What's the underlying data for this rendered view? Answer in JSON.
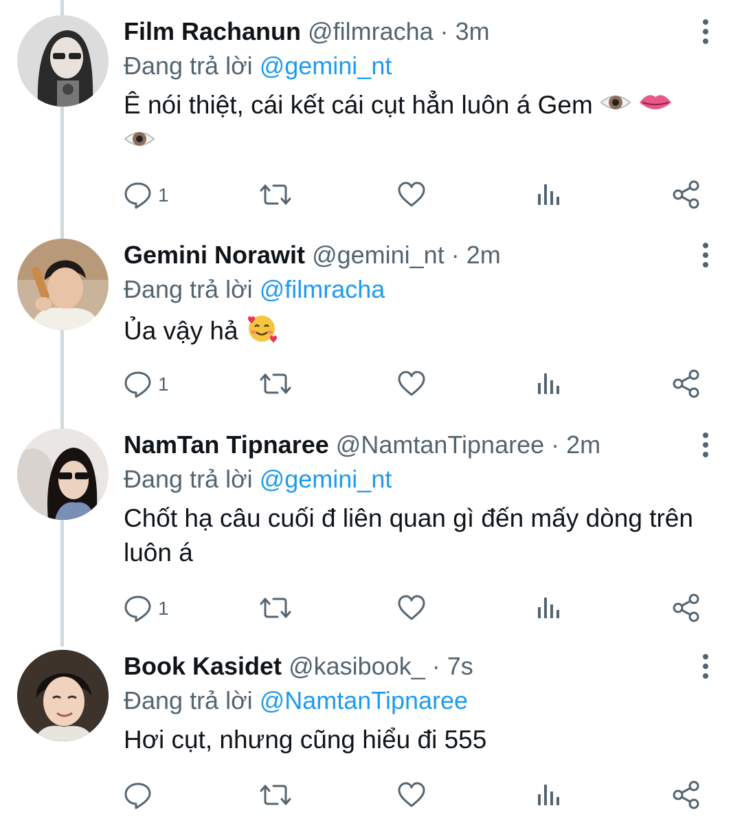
{
  "tweets": [
    {
      "display_name": "Film Rachanun",
      "handle": "@filmracha",
      "time": "3m",
      "reply_prefix": "Đang trả lời",
      "reply_to": "@gemini_nt",
      "text": "Ê nói thiệt, cái kết cái cụt hẳn luôn á Gem",
      "emojis": [
        "eye",
        "lips",
        "eye"
      ],
      "reply_count": "1"
    },
    {
      "display_name": "Gemini Norawit",
      "handle": "@gemini_nt",
      "time": "2m",
      "reply_prefix": "Đang trả lời",
      "reply_to": "@filmracha",
      "text": "Ủa vậy hả",
      "emojis": [
        "smiling-face-with-hearts"
      ],
      "reply_count": "1"
    },
    {
      "display_name": "NamTan Tipnaree",
      "handle": "@NamtanTipnaree",
      "time": "2m",
      "reply_prefix": "Đang trả lời",
      "reply_to": "@gemini_nt",
      "text": "Chốt hạ câu cuối đ liên quan gì đến mấy dòng trên luôn á",
      "emojis": [],
      "reply_count": "1"
    },
    {
      "display_name": "Book Kasidet",
      "handle": "@kasibook_",
      "time": "7s",
      "reply_prefix": "Đang trả lời",
      "reply_to": "@NamtanTipnaree",
      "text": "Hơi cụt, nhưng cũng hiểu đi 555",
      "emojis": [],
      "reply_count": ""
    }
  ],
  "separator": " · ",
  "icons": {
    "reply": "reply-icon",
    "retweet": "retweet-icon",
    "like": "heart-icon",
    "analytics": "analytics-icon",
    "share": "share-icon",
    "more": "more-options-icon"
  },
  "colors": {
    "text_primary": "#0f1419",
    "text_secondary": "#536471",
    "mention": "#1d9bf0",
    "thread_line": "#cfd9de"
  }
}
